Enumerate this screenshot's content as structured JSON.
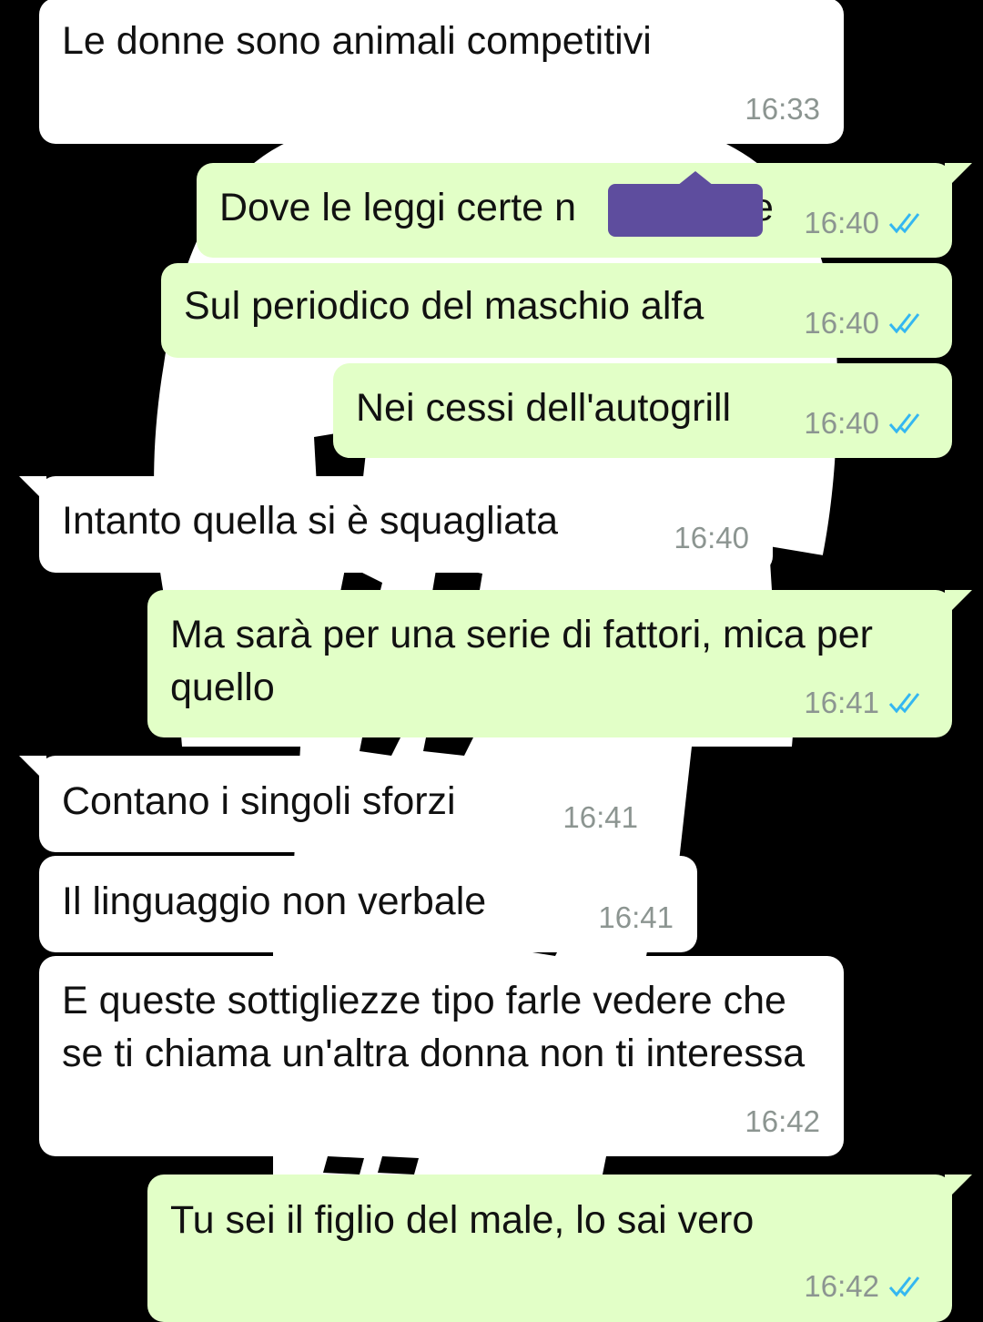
{
  "app": "WhatsApp",
  "colors": {
    "incoming_bubble": "#ffffff",
    "outgoing_bubble": "#e2ffc7",
    "timestamp": "#8c9591",
    "read_check": "#34b7f1",
    "redaction": "#5e4d9e",
    "wallpaper_background": "#000000"
  },
  "messages": [
    {
      "direction": "incoming",
      "text": "Le donne sono animali competitivi",
      "time": "16:33",
      "tail": false
    },
    {
      "direction": "outgoing",
      "text": "Dove le leggi certe n",
      "text_after_redaction": "e",
      "redacted": true,
      "time": "16:40",
      "status_icon": "double-check-icon",
      "status": "read",
      "tail": true
    },
    {
      "direction": "outgoing",
      "text": "Sul periodico del maschio alfa",
      "time": "16:40",
      "status_icon": "double-check-icon",
      "status": "read",
      "tail": false
    },
    {
      "direction": "outgoing",
      "text": "Nei cessi dell'autogrill",
      "time": "16:40",
      "status_icon": "double-check-icon",
      "status": "read",
      "tail": false
    },
    {
      "direction": "incoming",
      "text": "Intanto quella si è squagliata",
      "time": "16:40",
      "tail": true
    },
    {
      "direction": "outgoing",
      "text": "Ma sarà per una serie di fattori, mica per quello",
      "time": "16:41",
      "status_icon": "double-check-icon",
      "status": "read",
      "tail": true
    },
    {
      "direction": "incoming",
      "text": "Contano i singoli sforzi",
      "time": "16:41",
      "tail": true
    },
    {
      "direction": "incoming",
      "text": "Il linguaggio non verbale",
      "time": "16:41",
      "tail": false
    },
    {
      "direction": "incoming",
      "text": "E queste sottigliezze tipo farle vedere che se ti chiama un'altra donna non ti interessa",
      "time": "16:42",
      "tail": false
    },
    {
      "direction": "outgoing",
      "text": "Tu sei il figlio del male, lo sai vero",
      "time": "16:42",
      "status_icon": "double-check-icon",
      "status": "read",
      "tail": true
    }
  ]
}
